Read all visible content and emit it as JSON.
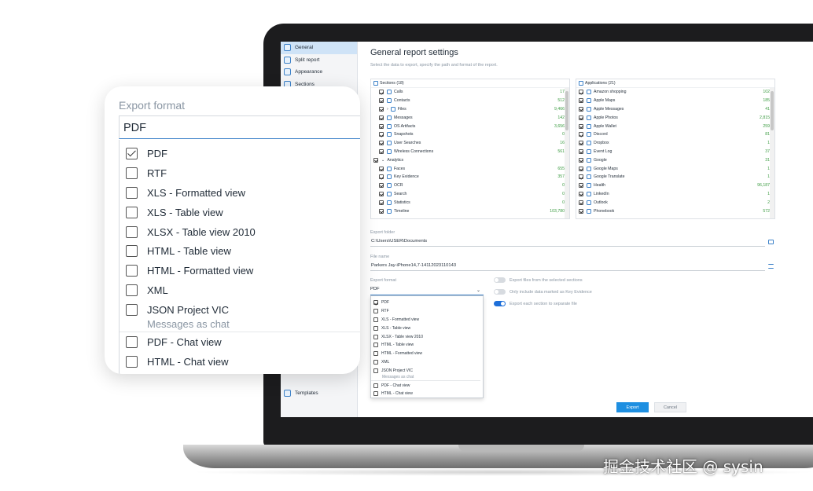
{
  "sidebar": {
    "items": [
      {
        "label": "General",
        "active": true
      },
      {
        "label": "Split report",
        "active": false
      },
      {
        "label": "Appearance",
        "active": false
      },
      {
        "label": "Sections",
        "active": false
      }
    ],
    "bottom_item": "Templates"
  },
  "header": {
    "title": "General report settings",
    "subtitle": "Select the data to export, specify the path and format of the report."
  },
  "sections_panel": {
    "header": "Sections (18)",
    "rows": [
      {
        "label": "Calls",
        "count": "17"
      },
      {
        "label": "Contacts",
        "count": "512"
      },
      {
        "label": "Files",
        "count": "9,466"
      },
      {
        "label": "Messages",
        "count": "142"
      },
      {
        "label": "OS Artifacts",
        "count": "3,656"
      },
      {
        "label": "Snapshots",
        "count": "0"
      },
      {
        "label": "User Searches",
        "count": "16"
      },
      {
        "label": "Wireless Connections",
        "count": "561"
      },
      {
        "label": "Analytics",
        "count": ""
      },
      {
        "label": "Faces",
        "count": "655"
      },
      {
        "label": "Key Evidence",
        "count": "357"
      },
      {
        "label": "OCR",
        "count": "0"
      },
      {
        "label": "Search",
        "count": "0"
      },
      {
        "label": "Statistics",
        "count": "0"
      },
      {
        "label": "Timeline",
        "count": "103,780"
      }
    ]
  },
  "applications_panel": {
    "header": "Applications (21)",
    "rows": [
      {
        "label": "Amazon shopping",
        "count": "102"
      },
      {
        "label": "Apple Maps",
        "count": "185"
      },
      {
        "label": "Apple Messages",
        "count": "41"
      },
      {
        "label": "Apple Photos",
        "count": "2,815"
      },
      {
        "label": "Apple Wallet",
        "count": "259"
      },
      {
        "label": "Discord",
        "count": "81"
      },
      {
        "label": "Dropbox",
        "count": "1"
      },
      {
        "label": "Event Log",
        "count": "37"
      },
      {
        "label": "Google",
        "count": "31"
      },
      {
        "label": "Google Maps",
        "count": "1"
      },
      {
        "label": "Google Translate",
        "count": "1"
      },
      {
        "label": "Health",
        "count": "96,187"
      },
      {
        "label": "LinkedIn",
        "count": "1"
      },
      {
        "label": "Outlook",
        "count": "2"
      },
      {
        "label": "Phonebook",
        "count": "572"
      }
    ]
  },
  "export_folder": {
    "label": "Export folder",
    "value": "C:\\Users\\USER\\Documents"
  },
  "file_name": {
    "label": "File name",
    "value": "Parkers Jay-iPhone14,7-14112023110143"
  },
  "export_format": {
    "label": "Export format",
    "selected": "PDF",
    "options": [
      {
        "label": "PDF",
        "checked": true
      },
      {
        "label": "RTF",
        "checked": false
      },
      {
        "label": "XLS - Formatted view",
        "checked": false
      },
      {
        "label": "XLS - Table view",
        "checked": false
      },
      {
        "label": "XLSX - Table view 2010",
        "checked": false
      },
      {
        "label": "HTML - Table view",
        "checked": false
      },
      {
        "label": "HTML - Formatted view",
        "checked": false
      },
      {
        "label": "XML",
        "checked": false
      },
      {
        "label": "JSON Project VIC",
        "checked": false
      }
    ],
    "group_label": "Messages as chat",
    "chat_options": [
      {
        "label": "PDF - Chat view",
        "checked": false
      },
      {
        "label": "HTML - Chat view",
        "checked": false
      }
    ]
  },
  "options": [
    {
      "label": "Export files from the selected sections",
      "on": false
    },
    {
      "label": "Only include data marked as Key Evidence",
      "on": false
    },
    {
      "label": "Export each section to separate file",
      "on": true
    }
  ],
  "buttons": {
    "export": "Export",
    "cancel": "Cancel"
  },
  "watermark": "掘金技术社区 @ sysin",
  "colors": {
    "accent": "#1e8fe1",
    "count_green": "#3b9b41",
    "active_nav": "#cfe3f7"
  }
}
